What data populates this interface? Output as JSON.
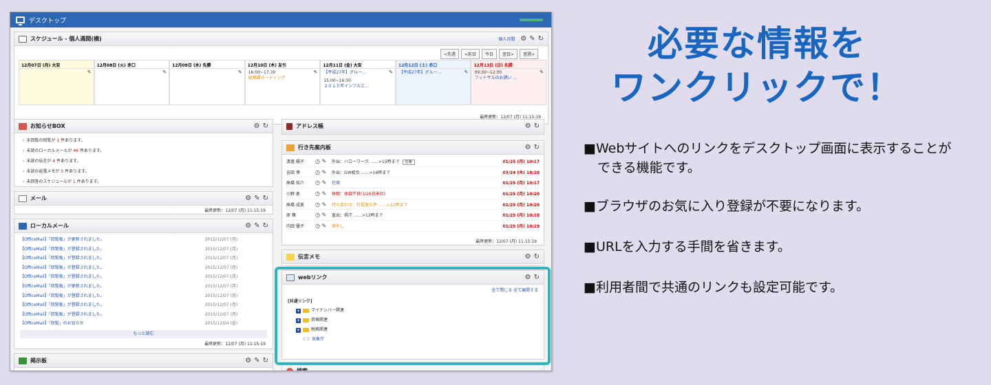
{
  "window": {
    "title": "デスクトップ"
  },
  "schedule": {
    "title": "スケジュール - 個人週間(横)",
    "personal_month": "個人月間",
    "nav": [
      "<先週",
      "<前日",
      "今日",
      "翌日>",
      "翌週>"
    ],
    "days": [
      {
        "label": "12月07日 (月) 大安",
        "color": "#fffbe0",
        "events": []
      },
      {
        "label": "12月08日 (火) 赤口",
        "color": "#ffffff",
        "events": []
      },
      {
        "label": "12月09日 (水) 先勝",
        "color": "#ffffff",
        "events": []
      },
      {
        "label": "12月10日 (木) 友引",
        "color": "#ffffff",
        "events": [
          {
            "time": "16:00~17:30",
            "text": "総務課ミーティング",
            "c": "#e08a00"
          }
        ]
      },
      {
        "label": "12月11日 (金) 大安",
        "color": "#ffffff",
        "events": [
          {
            "time": "【平成27年】グルー…",
            "text": "",
            "c": "#2255aa"
          },
          {
            "time": "15:00~16:30",
            "text": "２０１５年インフルエ…",
            "c": "#2255aa"
          }
        ]
      },
      {
        "label": "12月12日 (土) 赤口",
        "color": "#eef4ff",
        "events": [
          {
            "time": "【平成27年】グルー…",
            "text": "",
            "c": "#2255aa"
          }
        ]
      },
      {
        "label": "12月13日 (日) 先勝",
        "color": "#fff0f0",
        "events": [
          {
            "time": "09:30~12:00",
            "text": "フットサルのお誘い …",
            "c": "#2255aa"
          }
        ]
      }
    ],
    "updated": "最終更新：12/07 (月) 11:15:19"
  },
  "notice": {
    "title": "お知らせBOX",
    "items": [
      {
        "pre": "未回覧の回覧が ",
        "n": "1",
        "post": " 件あります。"
      },
      {
        "pre": "未読のローカルメールが ",
        "n": "46",
        "post": " 件あります。"
      },
      {
        "pre": "未読の伝言が ",
        "n": "4",
        "post": " 件あります。"
      },
      {
        "pre": "未読の返電メモが ",
        "n": "5",
        "post": " 件あります。"
      },
      {
        "pre": "未回答のスケジュールが ",
        "n": "1",
        "post": " 件あります。"
      }
    ]
  },
  "mail": {
    "title": "メール",
    "updated": "最終更新：12/07 (月) 11:15:19"
  },
  "localmail": {
    "title": "ローカルメール",
    "rows": [
      {
        "t": "【OfficeMail】「回覧板」が更新されました。",
        "d": "2015/12/07 (月)"
      },
      {
        "t": "【OfficeMail】「回覧板」が登録されました。",
        "d": "2015/12/07 (月)"
      },
      {
        "t": "【OfficeMail】「回覧板」が登録されました。",
        "d": "2015/12/07 (月)"
      },
      {
        "t": "【OfficeMail】「回覧板」が登録されました。",
        "d": "2015/12/07 (月)"
      },
      {
        "t": "【OfficeMail】「回覧板」が登録されました。",
        "d": "2015/12/07 (月)"
      },
      {
        "t": "【OfficeMail】「回覧板」が更新されました。",
        "d": "2015/12/07 (月)"
      },
      {
        "t": "【OfficeMail】「回覧板」が登録されました。",
        "d": "2015/12/07 (月)"
      },
      {
        "t": "【OfficeMail】「回覧板」が登録されました。",
        "d": "2015/12/07 (月)"
      },
      {
        "t": "【OfficeMail】「回覧板」が登録されました。",
        "d": "2015/12/07 (月)"
      },
      {
        "t": "【OfficeMail】「回覧」のお知らせ",
        "d": "2015/12/04 (金)"
      }
    ],
    "more": "もっと読む",
    "updated": "最終更新：12/07 (月) 11:15:19"
  },
  "bbs": {
    "title": "掲示板"
  },
  "address": {
    "title": "アドレス帳"
  },
  "whereabouts": {
    "title": "行き先案内板",
    "rows": [
      {
        "name": "渡邉 陽子",
        "status": "外出：ハローワーク ……>15時まで",
        "tag": "在席",
        "c": "#333333",
        "date": "01/25 (月) 10:17"
      },
      {
        "name": "吉田 博",
        "status": "外出：GW組合 ……>16時まで",
        "tag": "",
        "c": "#333333",
        "date": "03/24 (木) 18:20"
      },
      {
        "name": "高橋 祐介",
        "status": "在席",
        "tag": "",
        "c": "#2255aa",
        "date": "01/25 (月) 10:17"
      },
      {
        "name": "小野 恵",
        "status": "休暇：体調不良(1/26日来社)",
        "tag": "",
        "c": "#cc0000",
        "date": "01/25 (月) 10:20"
      },
      {
        "name": "高橋 成美",
        "status": "打ち合わせ：社長室の件 ……>12時まで",
        "tag": "",
        "c": "#e08a00",
        "date": "01/25 (月) 10:20"
      },
      {
        "name": "原 舞",
        "status": "直出：県庁 ……>13時まで",
        "tag": "",
        "c": "#333333",
        "date": "01/25 (月) 10:18"
      },
      {
        "name": "内田 優子",
        "status": "席外し",
        "tag": "",
        "c": "#e08a00",
        "date": "01/25 (月) 10:19"
      }
    ],
    "updated": "最終更新：12/07 (月) 11:15:19"
  },
  "memo": {
    "title": "伝言メモ"
  },
  "weblink": {
    "title": "webリンク",
    "controls": "全て閉じる 全て展開する",
    "group": "[共通リンク]",
    "folders": [
      "マイナンバー関連",
      "資格関連",
      "税務関連"
    ],
    "link": "気象庁"
  },
  "bottom_panel": {
    "title": "検索"
  },
  "promo": {
    "title_line1": "必要な情報を",
    "title_line2": "ワンクリックで！",
    "bullets": [
      "■Webサイトへのリンクをデスクトップ画面に表示することが",
      "できる機能です。",
      "■ブラウザのお気に入り登録が不要になります。",
      "■URLを入力する手間を省きます。",
      "■利用者間で共通のリンクも設定可能です。"
    ]
  },
  "colors": {
    "accent": "#1966c0",
    "highlight": "#2ab5c2",
    "titlebar": "#2b67b5"
  }
}
